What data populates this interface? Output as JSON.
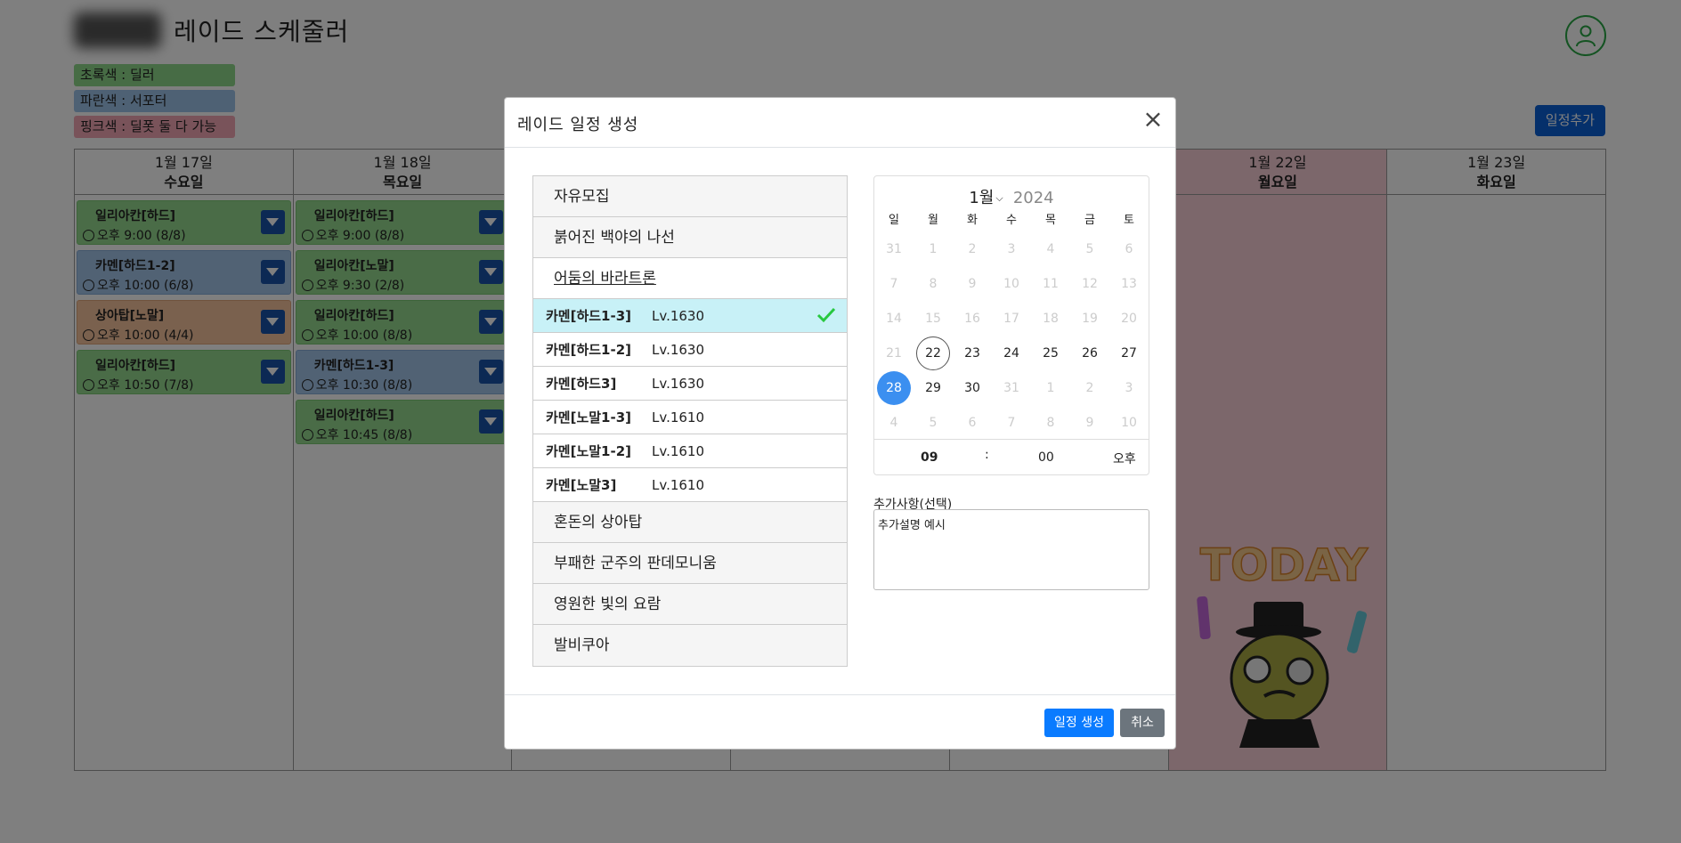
{
  "app": {
    "title": "레이드 스케줄러"
  },
  "legend": [
    "초록색 : 딜러",
    "파란색 : 서포터",
    "핑크색 : 딜폿 둘 다 가능"
  ],
  "toolbar": {
    "add_label": "일정추가"
  },
  "calendar": {
    "days": [
      {
        "date": "1월 17일",
        "weekday": "수요일",
        "today": false,
        "events": [
          {
            "name": "일리아칸[하드]",
            "time": "오후 9:00 (8/8)",
            "color": "green"
          },
          {
            "name": "카멘[하드1-2]",
            "time": "오후 10:00 (6/8)",
            "color": "blue"
          },
          {
            "name": "상아탑[노말]",
            "time": "오후 10:00 (4/4)",
            "color": "orange"
          },
          {
            "name": "일리아칸[하드]",
            "time": "오후 10:50 (7/8)",
            "color": "green"
          }
        ]
      },
      {
        "date": "1월 18일",
        "weekday": "목요일",
        "today": false,
        "events": [
          {
            "name": "일리아칸[하드]",
            "time": "오후 9:00 (8/8)",
            "color": "green"
          },
          {
            "name": "일리아칸[노말]",
            "time": "오후 9:30 (2/8)",
            "color": "green"
          },
          {
            "name": "일리아칸[하드]",
            "time": "오후 10:00 (8/8)",
            "color": "green"
          },
          {
            "name": "카멘[하드1-3]",
            "time": "오후 10:30 (8/8)",
            "color": "blue"
          },
          {
            "name": "일리아칸[하드]",
            "time": "오후 10:45 (8/8)",
            "color": "green"
          }
        ]
      },
      {
        "date": "",
        "weekday": "",
        "today": false,
        "events": []
      },
      {
        "date": "",
        "weekday": "",
        "today": false,
        "events": []
      },
      {
        "date": "",
        "weekday": "",
        "today": false,
        "events": []
      },
      {
        "date": "1월 22일",
        "weekday": "월요일",
        "today": true,
        "events": []
      },
      {
        "date": "1월 23일",
        "weekday": "화요일",
        "today": false,
        "events": []
      }
    ],
    "today_sticker": "TODAY"
  },
  "modal": {
    "title": "레이드 일정 생성",
    "close_symbol": "×",
    "raid_categories": [
      {
        "label": "자유모집",
        "open": false,
        "items": []
      },
      {
        "label": "붉어진 백야의 나선",
        "open": false,
        "items": []
      },
      {
        "label": "어둠의 바라트론",
        "open": true,
        "items": [
          {
            "name": "카멘[하드1-3]",
            "level": "Lv.1630",
            "selected": true
          },
          {
            "name": "카멘[하드1-2]",
            "level": "Lv.1630",
            "selected": false
          },
          {
            "name": "카멘[하드3]",
            "level": "Lv.1630",
            "selected": false
          },
          {
            "name": "카멘[노말1-3]",
            "level": "Lv.1610",
            "selected": false
          },
          {
            "name": "카멘[노말1-2]",
            "level": "Lv.1610",
            "selected": false
          },
          {
            "name": "카멘[노말3]",
            "level": "Lv.1610",
            "selected": false
          }
        ]
      },
      {
        "label": "혼돈의 상아탑",
        "open": false,
        "items": []
      },
      {
        "label": "부패한 군주의 판데모니움",
        "open": false,
        "items": []
      },
      {
        "label": "영원한 빛의 요람",
        "open": false,
        "items": []
      },
      {
        "label": "발비쿠아",
        "open": false,
        "items": []
      }
    ],
    "picker": {
      "month": "1월",
      "year": "2024",
      "weekdays": [
        "일",
        "월",
        "화",
        "수",
        "목",
        "금",
        "토"
      ],
      "days": [
        [
          "31",
          "dis"
        ],
        [
          "1",
          "dis"
        ],
        [
          "2",
          "dis"
        ],
        [
          "3",
          "dis"
        ],
        [
          "4",
          "dis"
        ],
        [
          "5",
          "dis"
        ],
        [
          "6",
          "dis"
        ],
        [
          "7",
          "dis"
        ],
        [
          "8",
          "dis"
        ],
        [
          "9",
          "dis"
        ],
        [
          "10",
          "dis"
        ],
        [
          "11",
          "dis"
        ],
        [
          "12",
          "dis"
        ],
        [
          "13",
          "dis"
        ],
        [
          "14",
          "dis"
        ],
        [
          "15",
          "dis"
        ],
        [
          "16",
          "dis"
        ],
        [
          "17",
          "dis"
        ],
        [
          "18",
          "dis"
        ],
        [
          "19",
          "dis"
        ],
        [
          "20",
          "dis"
        ],
        [
          "21",
          "dis"
        ],
        [
          "22",
          "today"
        ],
        [
          "23",
          ""
        ],
        [
          "24",
          ""
        ],
        [
          "25",
          ""
        ],
        [
          "26",
          ""
        ],
        [
          "27",
          ""
        ],
        [
          "28",
          "sel"
        ],
        [
          "29",
          ""
        ],
        [
          "30",
          ""
        ],
        [
          "31",
          "dis"
        ],
        [
          "1",
          "dis"
        ],
        [
          "2",
          "dis"
        ],
        [
          "3",
          "dis"
        ],
        [
          "4",
          "dis"
        ],
        [
          "5",
          "dis"
        ],
        [
          "6",
          "dis"
        ],
        [
          "7",
          "dis"
        ],
        [
          "8",
          "dis"
        ],
        [
          "9",
          "dis"
        ],
        [
          "10",
          "dis"
        ]
      ],
      "hour": "09",
      "separator": ":",
      "minute": "00",
      "ampm": "오후"
    },
    "note": {
      "label": "추가사항(선택)",
      "value": "추가설명 예시"
    },
    "footer": {
      "create_label": "일정 생성",
      "cancel_label": "취소"
    }
  }
}
